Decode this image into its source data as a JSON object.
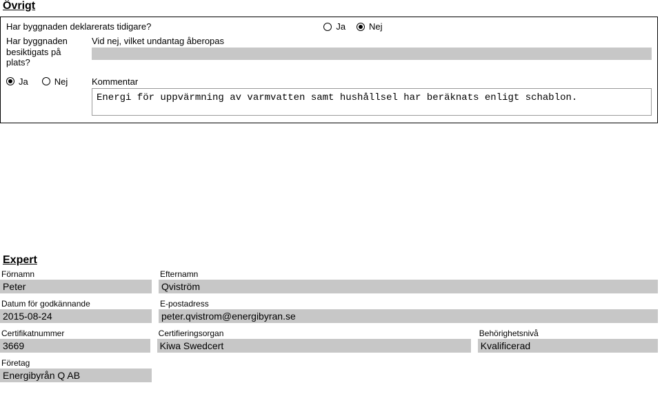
{
  "ovrigt": {
    "title": "Övrigt",
    "q1": {
      "label": "Har byggnaden deklarerats tidigare?",
      "ja": "Ja",
      "nej": "Nej",
      "selected": "nej"
    },
    "q2": {
      "left_label": "Har byggnaden besiktigats på plats?",
      "right_label": "Vid nej, vilket undantag åberopas",
      "value": ""
    },
    "q3": {
      "ja": "Ja",
      "nej": "Nej",
      "selected": "ja",
      "kommentar_label": "Kommentar",
      "kommentar_value": "Energi för uppvärmning av varmvatten samt hushållsel har beräknats enligt schablon."
    }
  },
  "expert": {
    "title": "Expert",
    "fornamn_label": "Förnamn",
    "fornamn_value": "Peter",
    "efternamn_label": "Efternamn",
    "efternamn_value": "Qviström",
    "datum_label": "Datum för godkännande",
    "datum_value": "2015-08-24",
    "epost_label": "E-postadress",
    "epost_value": "peter.qvistrom@energibyran.se",
    "cert_label": "Certifikatnummer",
    "cert_value": "3669",
    "certorg_label": "Certifieringsorgan",
    "certorg_value": "Kiwa Swedcert",
    "behor_label": "Behörighetsnivå",
    "behor_value": "Kvalificerad",
    "foretag_label": "Företag",
    "foretag_value": "Energibyrån Q AB"
  }
}
